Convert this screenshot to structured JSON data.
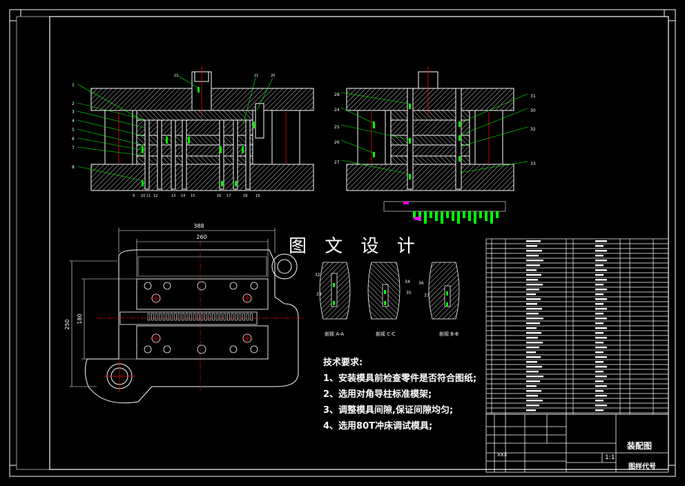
{
  "watermark": "图 文 设 计",
  "technical_notes": {
    "heading": "技术要求:",
    "items": [
      "1、安装模具前检查零件是否符合图纸;",
      "2、选用对角导柱标准模架;",
      "3、调整模具间隙,保证间隙均匀;",
      "4、选用80T冲床调试模具;"
    ]
  },
  "section_labels": [
    "剖视 A-A",
    "剖视 C-C",
    "剖视 B-B"
  ],
  "dimensions": {
    "overall_width": "388",
    "inner_width": "260",
    "overall_height": "250",
    "inner_height": "180"
  },
  "part_numbers_left": [
    "1",
    "2",
    "3",
    "4",
    "5",
    "6",
    "7",
    "8"
  ],
  "part_numbers_top": [
    "22",
    "21",
    "20"
  ],
  "part_numbers_bottom": [
    "9",
    "10",
    "11",
    "12",
    "13",
    "14",
    "15",
    "16",
    "17",
    "18",
    "19"
  ],
  "part_numbers_right_a": [
    "28",
    "24",
    "25",
    "26",
    "27"
  ],
  "part_numbers_right_b": [
    "31",
    "30",
    "32",
    "33"
  ],
  "detail_labels": [
    "32",
    "33",
    "34",
    "35",
    "36",
    "37"
  ],
  "title_block": {
    "drawing_name": "装配图",
    "drawing_code": "图样代号",
    "scale": "1:1",
    "designer": "XXX"
  },
  "colors": {
    "line": "#ffffff",
    "hatch": "#ffffff",
    "green": "#00ff00",
    "red": "#ff0000",
    "magenta": "#ff00ff",
    "cyan": "#00ffff",
    "background": "#000000"
  }
}
